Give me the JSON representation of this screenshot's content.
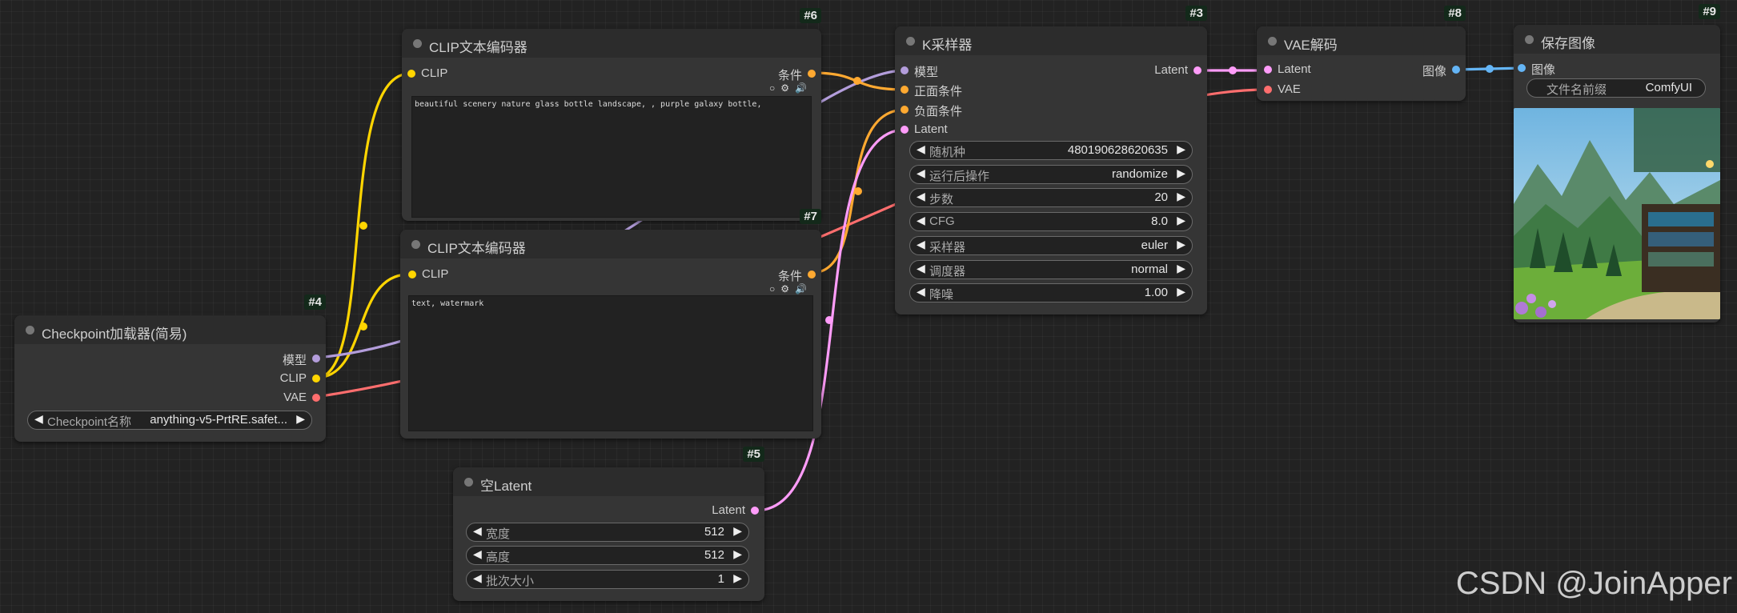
{
  "colors": {
    "model": "#b39ddb",
    "clip": "#ffd500",
    "vae": "#ff6e6e",
    "latent": "#ff9cf9",
    "conditioning": "#ffa931",
    "image": "#64b5f6"
  },
  "nodes": {
    "clip_pos": {
      "id": "#6",
      "title": "CLIP文本编码器",
      "input_clip": "CLIP",
      "output": "条件",
      "text": "beautiful scenery nature glass bottle landscape, , purple galaxy bottle,"
    },
    "clip_neg": {
      "id": "#7",
      "title": "CLIP文本编码器",
      "input_clip": "CLIP",
      "output": "条件",
      "text": "text, watermark"
    },
    "checkpoint": {
      "id": "#4",
      "title": "Checkpoint加载器(简易)",
      "out_model": "模型",
      "out_clip": "CLIP",
      "out_vae": "VAE",
      "widget_label": "Checkpoint名称",
      "widget_value": "anything-v5-PrtRE.safet..."
    },
    "latent": {
      "id": "#5",
      "title": "空Latent",
      "output": "Latent",
      "widgets": [
        {
          "label": "宽度",
          "value": "512"
        },
        {
          "label": "高度",
          "value": "512"
        },
        {
          "label": "批次大小",
          "value": "1"
        }
      ]
    },
    "ksampler": {
      "id": "#3",
      "title": "K采样器",
      "in_model": "模型",
      "in_pos": "正面条件",
      "in_neg": "负面条件",
      "in_latent": "Latent",
      "output": "Latent",
      "widgets": [
        {
          "label": "随机种",
          "value": "480190628620635"
        },
        {
          "label": "运行后操作",
          "value": "randomize"
        },
        {
          "label": "步数",
          "value": "20"
        },
        {
          "label": "CFG",
          "value": "8.0"
        },
        {
          "label": "采样器",
          "value": "euler"
        },
        {
          "label": "调度器",
          "value": "normal"
        },
        {
          "label": "降噪",
          "value": "1.00"
        }
      ]
    },
    "vae": {
      "id": "#8",
      "title": "VAE解码",
      "in_latent": "Latent",
      "in_vae": "VAE",
      "output": "图像"
    },
    "save": {
      "id": "#9",
      "title": "保存图像",
      "input": "图像",
      "widget_label": "文件名前缀",
      "widget_value": "ComfyUI"
    }
  },
  "icons": {
    "circle": "○",
    "gear": "⚙",
    "speaker": "🔊",
    "arrow_left": "◀",
    "arrow_right": "▶"
  },
  "watermark": "CSDN @JoinApper"
}
